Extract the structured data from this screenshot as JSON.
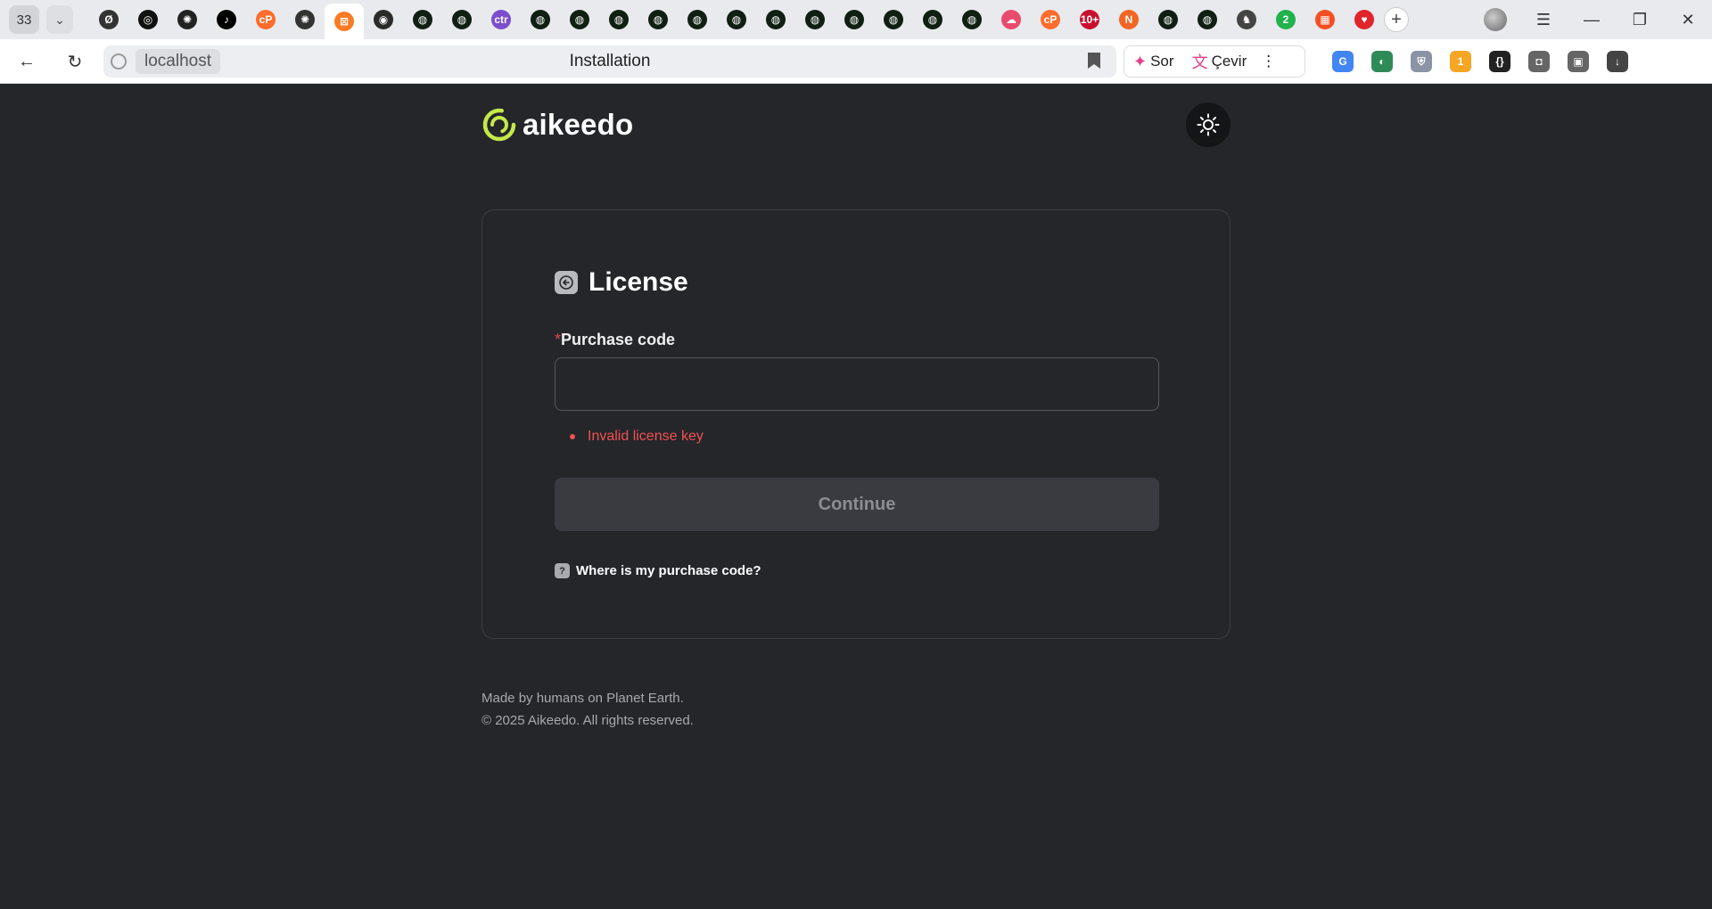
{
  "browser": {
    "tab_count": "33",
    "tab_icons": [
      {
        "name": "tab-perplexity-icon",
        "color": "#333333",
        "glyph": "Ø"
      },
      {
        "name": "tab-chatgpt-icon",
        "color": "#111111",
        "glyph": "◎"
      },
      {
        "name": "tab-openai-icon",
        "color": "#222222",
        "glyph": "✺"
      },
      {
        "name": "tab-tiktok-icon",
        "color": "#000000",
        "glyph": "♪"
      },
      {
        "name": "tab-cpanel-icon",
        "color": "#ff6c2c",
        "glyph": "cP"
      },
      {
        "name": "tab-chatgpt-icon-2",
        "color": "#333333",
        "glyph": "✺"
      },
      {
        "name": "tab-xampp-icon",
        "color": "#fb7a24",
        "glyph": "⊠"
      },
      {
        "name": "tab-green-ring-icon",
        "color": "#2b2b2b",
        "glyph": "◉"
      },
      {
        "name": "tab-greenapp-icon",
        "color": "#0f1f12",
        "glyph": "◍"
      },
      {
        "name": "tab-greenapp-icon-2",
        "color": "#0f1f12",
        "glyph": "◍"
      },
      {
        "name": "tab-ctr-icon",
        "color": "#7c4dcc",
        "glyph": "ctr"
      },
      {
        "name": "tab-greenapp-icon-3",
        "color": "#0f1f12",
        "glyph": "◍"
      },
      {
        "name": "tab-greenapp-icon-4",
        "color": "#0f1f12",
        "glyph": "◍"
      },
      {
        "name": "tab-greenapp-icon-5",
        "color": "#0f1f12",
        "glyph": "◍"
      },
      {
        "name": "tab-greenapp-icon-6",
        "color": "#0f1f12",
        "glyph": "◍"
      },
      {
        "name": "tab-greenapp-icon-7",
        "color": "#0f1f12",
        "glyph": "◍"
      },
      {
        "name": "tab-greenapp-icon-8",
        "color": "#0f1f12",
        "glyph": "◍"
      },
      {
        "name": "tab-greenapp-icon-9",
        "color": "#0f1f12",
        "glyph": "◍"
      },
      {
        "name": "tab-greenapp-icon-10",
        "color": "#0f1f12",
        "glyph": "◍"
      },
      {
        "name": "tab-greenapp-icon-11",
        "color": "#0f1f12",
        "glyph": "◍"
      },
      {
        "name": "tab-greenapp-icon-12",
        "color": "#0f1f12",
        "glyph": "◍"
      },
      {
        "name": "tab-greenapp-icon-13",
        "color": "#0f1f12",
        "glyph": "◍"
      },
      {
        "name": "tab-greenapp-icon-14",
        "color": "#0f1f12",
        "glyph": "◍"
      },
      {
        "name": "tab-cloud-icon",
        "color": "#e94b6d",
        "glyph": "☁"
      },
      {
        "name": "tab-cpanel-icon-2",
        "color": "#ff6c2c",
        "glyph": "cP"
      },
      {
        "name": "tab-10plus-icon",
        "color": "#c8102e",
        "glyph": "10+"
      },
      {
        "name": "tab-orange-n-icon",
        "color": "#f26522",
        "glyph": "N"
      },
      {
        "name": "tab-greenapp-icon-15",
        "color": "#0f1f12",
        "glyph": "◍"
      },
      {
        "name": "tab-greenapp-icon-16",
        "color": "#0f1f12",
        "glyph": "◍"
      },
      {
        "name": "tab-bunny-icon",
        "color": "#444444",
        "glyph": "♞"
      },
      {
        "name": "tab-badge-2-icon",
        "color": "#22b14c",
        "glyph": "2"
      },
      {
        "name": "tab-microsoft-icon",
        "color": "#f25022",
        "glyph": "▦"
      },
      {
        "name": "tab-heart-icon",
        "color": "#e0252b",
        "glyph": "♥"
      }
    ],
    "active_tab_index": 6,
    "new_tab": "+",
    "address_host": "localhost",
    "page_title": "Installation",
    "ai_ask_label": "Sor",
    "ai_translate_label": "Çevir",
    "extensions": [
      {
        "name": "google-translate-icon",
        "color": "#4285f4",
        "glyph": "G"
      },
      {
        "name": "earth-extension-icon",
        "color": "#2e8b57",
        "glyph": "◐"
      },
      {
        "name": "shield-extension-icon",
        "color": "#8a94a6",
        "glyph": "⛨"
      },
      {
        "name": "cookie-extension-icon",
        "color": "#f5a623",
        "glyph": "1"
      },
      {
        "name": "json-extension-icon",
        "color": "#222222",
        "glyph": "{}"
      },
      {
        "name": "camera-icon",
        "color": "#666666",
        "glyph": "◘"
      },
      {
        "name": "extensions-icon",
        "color": "#666666",
        "glyph": "▣"
      },
      {
        "name": "download-icon",
        "color": "#444444",
        "glyph": "↓"
      }
    ]
  },
  "app": {
    "brand_name": "aikeedo",
    "brand_color": "#c5e84a",
    "card_title": "License",
    "purchase_code_label": "Purchase code",
    "required_marker": "*",
    "purchase_code_value": "",
    "error_message": "Invalid license key",
    "continue_label": "Continue",
    "help_link": "Where is my purchase code?",
    "help_icon_glyph": "?",
    "footer_line1": "Made by humans on Planet Earth.",
    "footer_line2": "© 2025 Aikeedo. All rights reserved."
  }
}
